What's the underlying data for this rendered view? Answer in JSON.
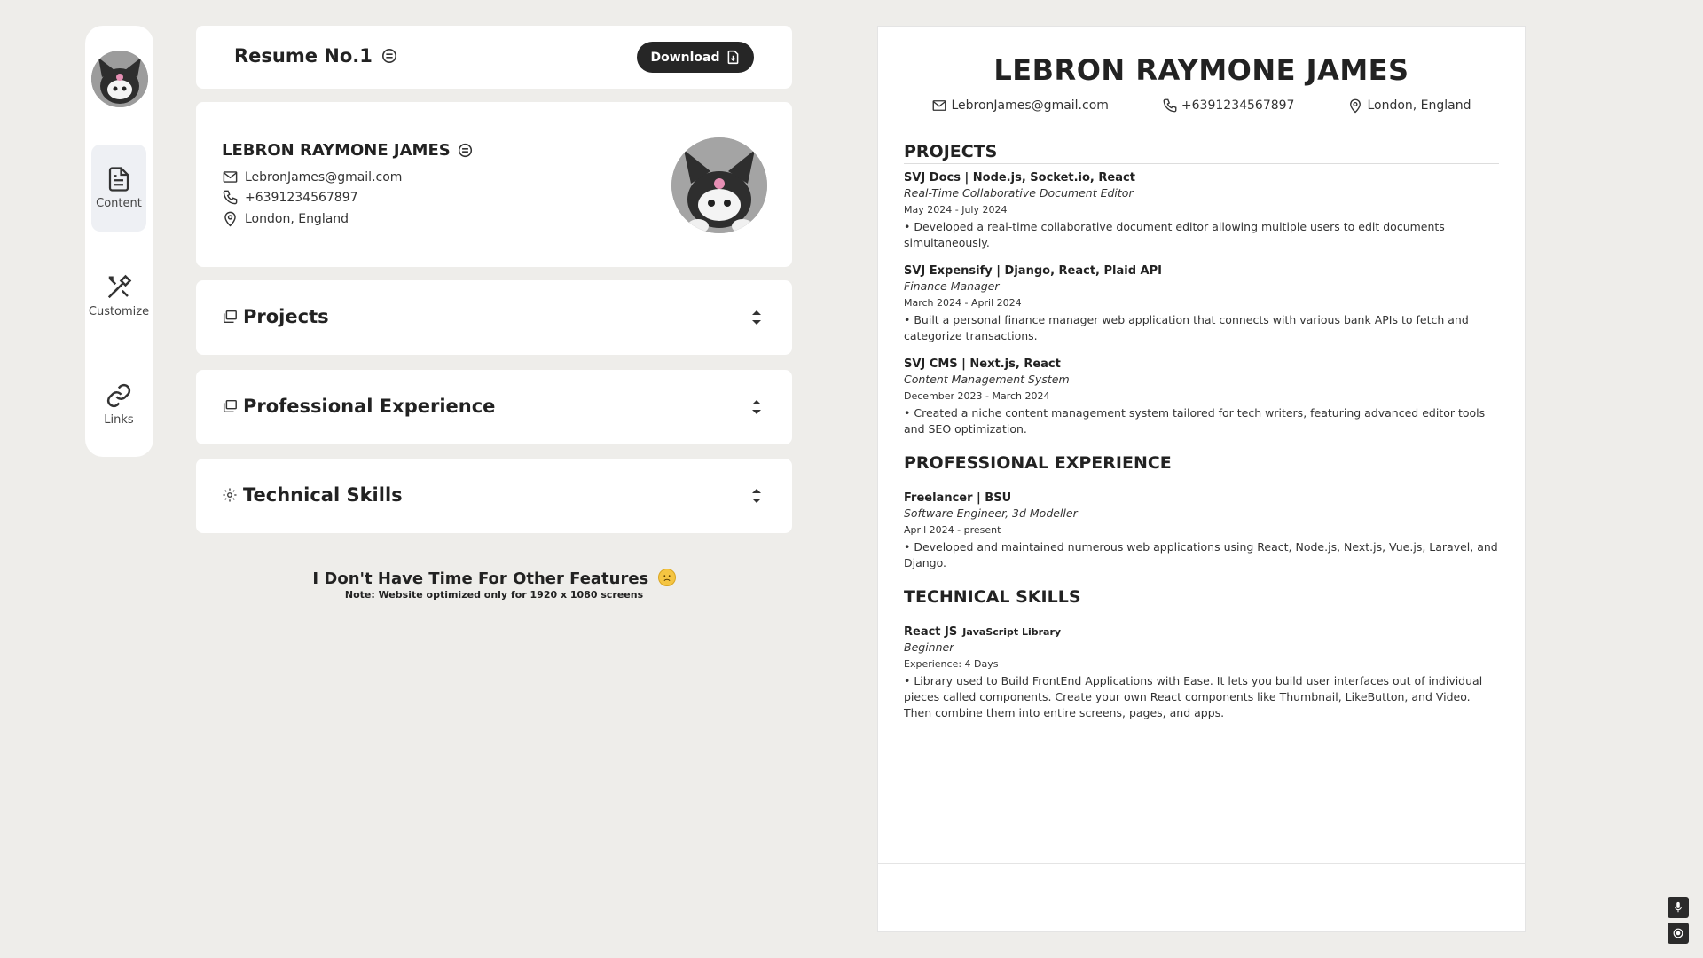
{
  "sidebar": {
    "items": [
      {
        "label": "Content",
        "icon": "document-icon",
        "active": true
      },
      {
        "label": "Customize",
        "icon": "tools-icon"
      },
      {
        "label": "Links",
        "icon": "link-icon"
      }
    ]
  },
  "header": {
    "title": "Resume No.1",
    "download_label": "Download"
  },
  "profile": {
    "name": "LEBRON RAYMONE JAMES",
    "email": "LebronJames@gmail.com",
    "phone": "+6391234567897",
    "location": "London, England"
  },
  "sections": [
    {
      "label": "Projects",
      "icon": "folders-icon"
    },
    {
      "label": "Professional Experience",
      "icon": "folders-icon"
    },
    {
      "label": "Technical Skills",
      "icon": "gear-icon"
    }
  ],
  "footer": {
    "title": "I Don't Have Time For Other Features",
    "note": "Note: Website optimized only for 1920 x 1080 screens"
  },
  "preview": {
    "name": "LEBRON RAYMONE JAMES",
    "email": "LebronJames@gmail.com",
    "phone": "+6391234567897",
    "location": "London, England",
    "projects_title": "PROJECTS",
    "projects": [
      {
        "head": "SVJ Docs | Node.js, Socket.io, React",
        "role": "Real-Time Collaborative Document Editor",
        "date": "May 2024 - July 2024",
        "bullet": "•  Developed a real-time collaborative document editor allowing multiple users to edit documents simultaneously."
      },
      {
        "head": "SVJ Expensify | Django, React, Plaid API",
        "role": "Finance Manager",
        "date": "March 2024 - April 2024",
        "bullet": "•  Built a personal finance manager web application that connects with various bank APIs to fetch and categorize transactions."
      },
      {
        "head": "SVJ CMS | Next.js, React",
        "role": "Content Management System",
        "date": "December 2023 - March 2024",
        "bullet": "•  Created a niche content management system tailored for tech writers, featuring advanced editor tools and SEO optimization."
      }
    ],
    "experience_title": "PROFESSIONAL EXPERIENCE",
    "experience": [
      {
        "head": "Freelancer | BSU",
        "role": "Software Engineer, 3d Modeller",
        "date": "April 2024 - present",
        "bullet": "•  Developed and maintained numerous web applications using React, Node.js, Next.js, Vue.js, Laravel, and Django."
      }
    ],
    "skills_title": "TECHNICAL SKILLS",
    "skills": [
      {
        "head": "React JS",
        "sub": "JavaScript Library",
        "level": "Beginner",
        "experience": "Experience: 4 Days",
        "bullet": "•  Library used to Build FrontEnd Applications with Ease. It lets you build user interfaces out of individual pieces called components. Create your own React components like Thumbnail, LikeButton, and Video. Then combine them into entire screens, pages, and apps."
      }
    ]
  },
  "corner_buttons": [
    {
      "icon": "microphone-icon"
    },
    {
      "icon": "target-icon"
    }
  ]
}
